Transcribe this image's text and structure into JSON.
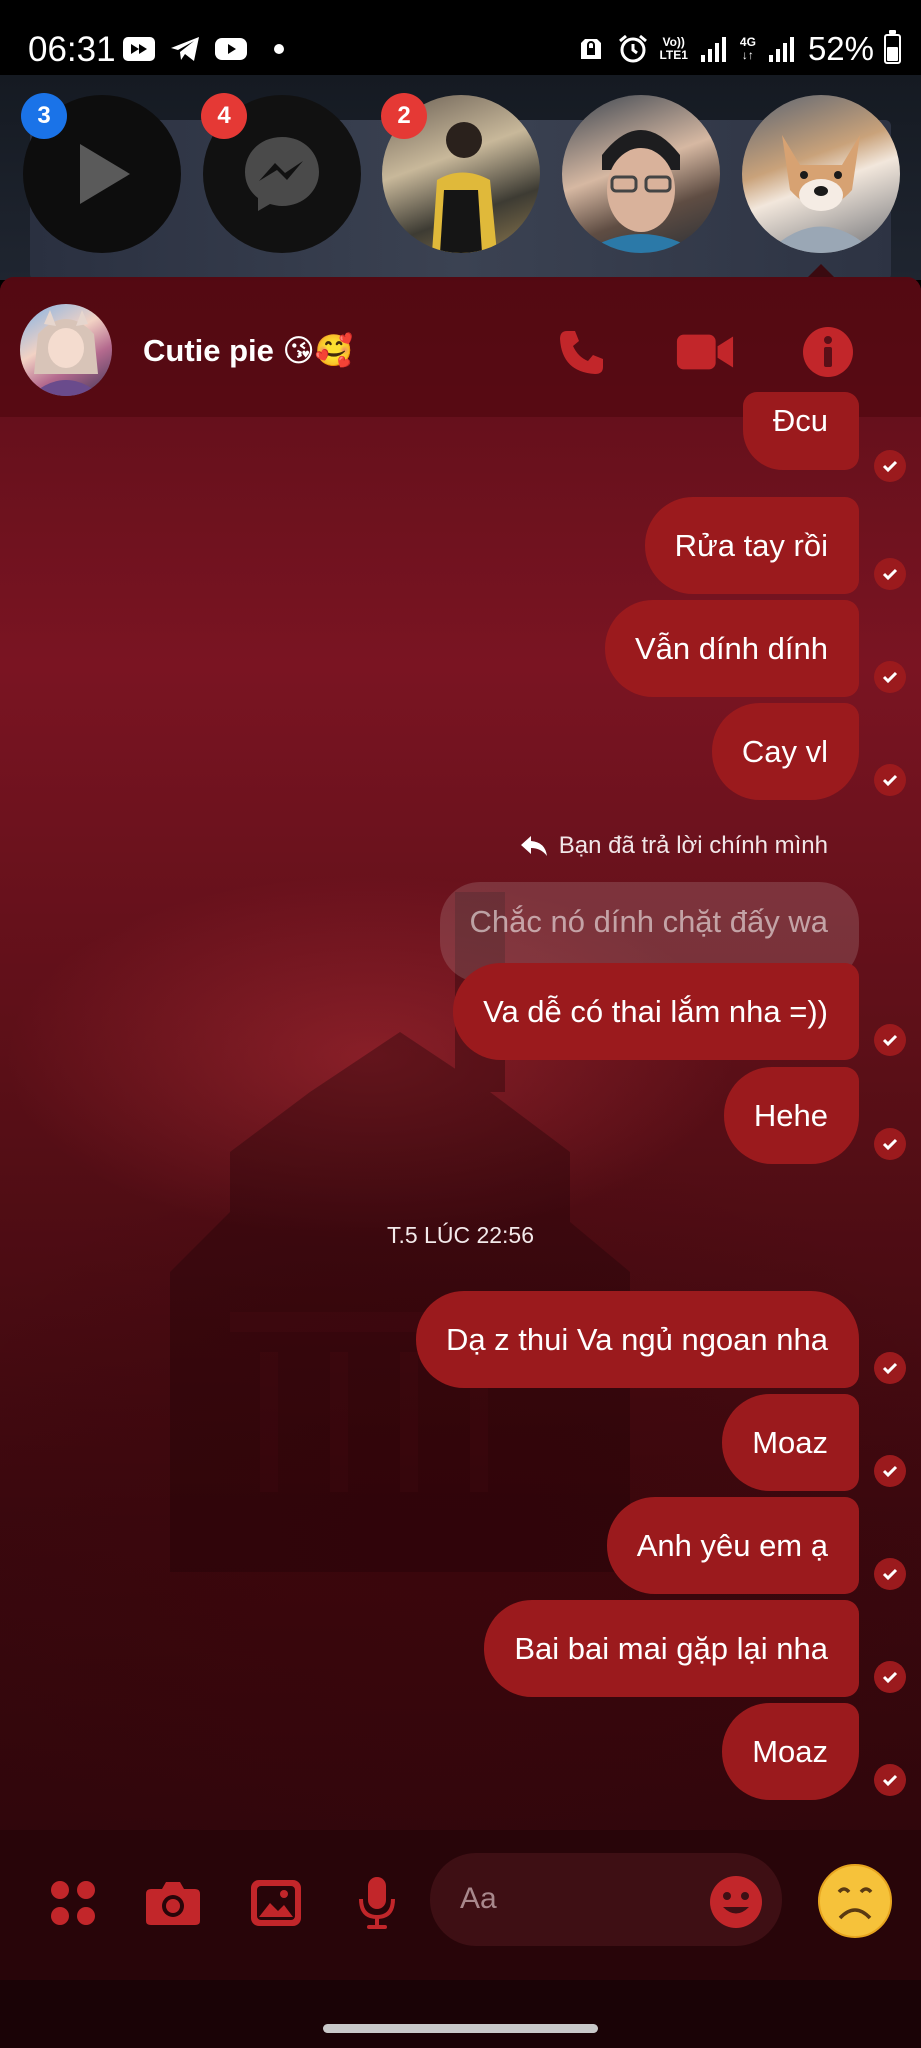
{
  "status_bar": {
    "time": "06:31",
    "network_label_1_top": "Vo))",
    "network_label_1_bottom": "LTE1",
    "network_label_2": "4G",
    "battery": "52%",
    "battery_level": 0.52,
    "left_icons": [
      "screen-record-icon",
      "telegram-icon",
      "youtube-icon",
      "more-dot-icon"
    ],
    "right_icons": [
      "alarm-lock-icon",
      "alarm-clock-icon",
      "signal-icon",
      "signal-icon",
      "battery-icon"
    ]
  },
  "chat_heads": [
    {
      "name": "play-chat-head",
      "badge": "3",
      "badge_color": "#1a73e8"
    },
    {
      "name": "messenger-chat-head",
      "badge": "4",
      "badge_color": "#e53935"
    },
    {
      "name": "contact-chat-head-1",
      "badge": "2",
      "badge_color": "#e53935"
    },
    {
      "name": "contact-chat-head-2",
      "badge": ""
    },
    {
      "name": "contact-chat-head-3",
      "badge": ""
    }
  ],
  "chat": {
    "contact_name": "Cutie pie 😘🥰",
    "accent_color": "#9b1a1d",
    "header_icons": [
      "phone-icon",
      "video-call-icon",
      "info-icon"
    ],
    "messages_before": [
      {
        "text": "Đcu"
      },
      {
        "text": "Rửa tay rồi"
      },
      {
        "text": "Vẫn dính dính"
      },
      {
        "text": "Cay vl"
      }
    ],
    "reply_note": "Bạn đã trả lời chính mình",
    "quoted_text": "Chắc nó dính chặt đấy wa",
    "messages_after_reply": [
      {
        "text": "Va dễ có thai lắm nha =))"
      },
      {
        "text": "Hehe"
      }
    ],
    "timestamp": "T.5 LÚC 22:56",
    "messages_late": [
      {
        "text": "Dạ z thui Va ngủ ngoan nha"
      },
      {
        "text": "Moaz"
      },
      {
        "text": "Anh yêu em ạ"
      },
      {
        "text": "Bai bai mai gặp lại nha"
      },
      {
        "text": "Moaz"
      }
    ]
  },
  "composer": {
    "placeholder": "Aa",
    "icons": [
      "apps-menu-icon",
      "camera-icon",
      "gallery-icon",
      "microphone-icon",
      "emoji-icon",
      "quick-reaction-icon"
    ]
  }
}
